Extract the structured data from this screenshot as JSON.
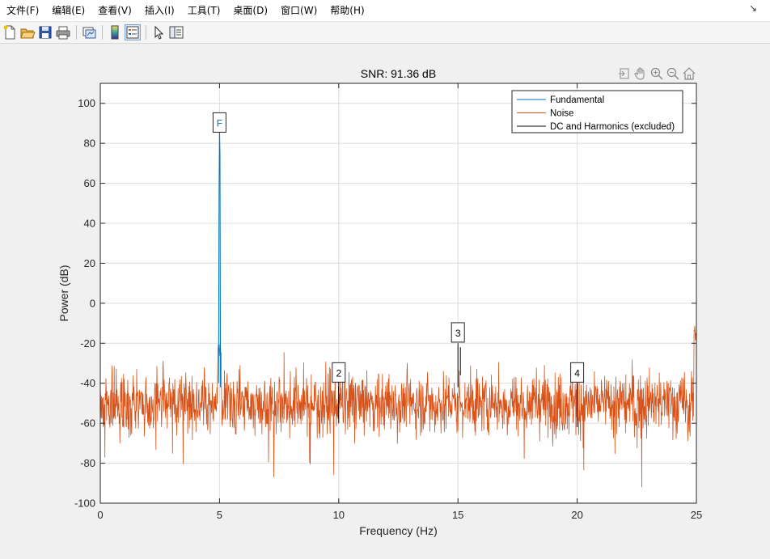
{
  "menubar": {
    "items": [
      "文件(F)",
      "编辑(E)",
      "查看(V)",
      "插入(I)",
      "工具(T)",
      "桌面(D)",
      "窗口(W)",
      "帮助(H)"
    ],
    "arrow": "↘"
  },
  "toolbar": {
    "icons": [
      "new-figure-icon",
      "open-file-icon",
      "save-icon",
      "print-icon",
      "link-plot-icon",
      "colorbar-icon",
      "legend-icon",
      "pointer-icon",
      "property-inspector-icon"
    ]
  },
  "axes_toolbar": {
    "icons": [
      "export-icon",
      "pan-hand-icon",
      "zoom-in-icon",
      "zoom-out-icon",
      "home-icon"
    ]
  },
  "colors": {
    "fundamental": "#0072BD",
    "noise": "#D95319",
    "harmonics": "#000000",
    "grid": "#dcdcdc",
    "axes_bg": "#ffffff"
  },
  "chart_data": {
    "type": "line",
    "title": "SNR:  91.36 dB",
    "xlabel": "Frequency (Hz)",
    "ylabel": "Power (dB)",
    "xlim": [
      0,
      25
    ],
    "ylim": [
      -100,
      110
    ],
    "xticks": [
      0,
      5,
      10,
      15,
      20,
      25
    ],
    "yticks": [
      -100,
      -80,
      -60,
      -40,
      -20,
      0,
      20,
      40,
      60,
      80,
      100
    ],
    "grid": true,
    "legend_position": "top-right",
    "series": [
      {
        "name": "Fundamental",
        "color": "#0072BD",
        "x": [
          4.96,
          4.98,
          5.0,
          5.02,
          5.04
        ],
        "y": [
          -40,
          52,
          88,
          74,
          -42
        ]
      },
      {
        "name": "Noise",
        "color": "#D95319",
        "x": [
          0,
          25
        ],
        "y": [
          -50,
          -50
        ],
        "noise_baseline_db": -50,
        "noise_spread_db": 8
      },
      {
        "name": "DC and Harmonics (excluded)",
        "color": "#000000",
        "x": [
          0,
          10,
          15,
          20,
          25
        ],
        "y": [
          -6,
          -38,
          -20,
          -40,
          -12
        ]
      }
    ],
    "annotations": [
      {
        "text": "F",
        "x": 5,
        "y": 90,
        "color": "#0072BD"
      },
      {
        "text": "2",
        "x": 10,
        "y": -35,
        "color": "#000000"
      },
      {
        "text": "3",
        "x": 15,
        "y": -15,
        "color": "#000000"
      },
      {
        "text": "4",
        "x": 20,
        "y": -35,
        "color": "#000000"
      }
    ]
  }
}
